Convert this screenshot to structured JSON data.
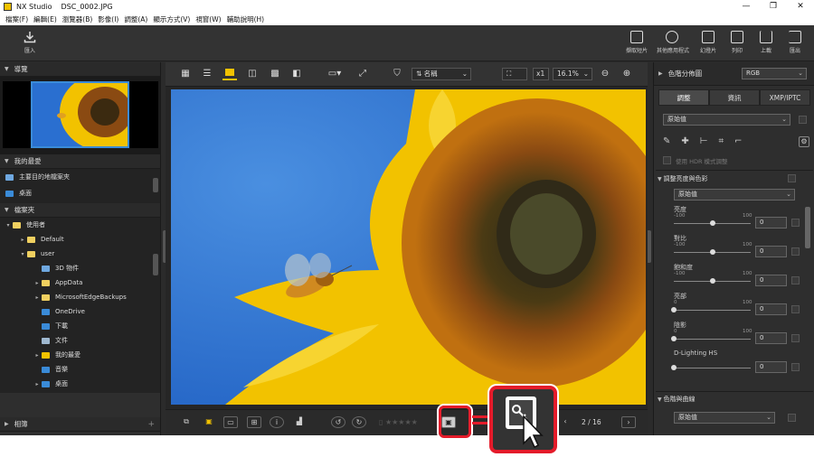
{
  "window": {
    "app_name": "NX Studio",
    "file_name": "DSC_0002.JPG"
  },
  "menu": [
    "檔案(F)",
    "編輯(E)",
    "瀏覽器(B)",
    "影像(I)",
    "調整(A)",
    "顯示方式(V)",
    "視窗(W)",
    "輔助說明(H)"
  ],
  "toolbar": {
    "import": "匯入",
    "right": [
      "擷取短片",
      "其他應用程式",
      "幻燈片",
      "列印",
      "上載",
      "匯出"
    ]
  },
  "left": {
    "navigation_title": "導覽",
    "favorites_title": "我的最愛",
    "favorites_item": "主要目的地檔案夾",
    "desktop_partial": "桌面",
    "folders_title": "檔案夾",
    "tree": [
      {
        "label": "使用者",
        "indent": 0,
        "arrow": "▾",
        "icon": "folder"
      },
      {
        "label": "Default",
        "indent": 1,
        "arrow": "▸",
        "icon": "folder"
      },
      {
        "label": "user",
        "indent": 1,
        "arrow": "▾",
        "icon": "folder"
      },
      {
        "label": "3D 物件",
        "indent": 2,
        "arrow": "",
        "icon": "cube"
      },
      {
        "label": "AppData",
        "indent": 2,
        "arrow": "▸",
        "icon": "folder"
      },
      {
        "label": "MicrosoftEdgeBackups",
        "indent": 2,
        "arrow": "▸",
        "icon": "folder"
      },
      {
        "label": "OneDrive",
        "indent": 2,
        "arrow": "",
        "icon": "cloud"
      },
      {
        "label": "下載",
        "indent": 2,
        "arrow": "",
        "icon": "download"
      },
      {
        "label": "文件",
        "indent": 2,
        "arrow": "",
        "icon": "doc"
      },
      {
        "label": "我的最愛",
        "indent": 2,
        "arrow": "▸",
        "icon": "star"
      },
      {
        "label": "音樂",
        "indent": 2,
        "arrow": "",
        "icon": "music"
      },
      {
        "label": "桌面",
        "indent": 2,
        "arrow": "▸",
        "icon": "desktop"
      }
    ],
    "album_title": "相簿"
  },
  "viewer_toolbar": {
    "sort_label": "名稱",
    "zoom_mult": "x1",
    "zoom_value": "16.1%"
  },
  "bottom": {
    "page_counter": "2 / 16"
  },
  "right": {
    "histogram_title": "色階分佈圖",
    "histogram_mode": "RGB",
    "tabs": [
      "調整",
      "資訊",
      "XMP/IPTC"
    ],
    "preset": "原始值",
    "hdr_label": "使用 HDR 模式調整",
    "section_brightness": "調整亮度與色彩",
    "section_preset": "原始值",
    "sliders": [
      {
        "label": "亮度",
        "min": "-100",
        "max": "100",
        "value": "0",
        "level": 0.5,
        "ranged": true
      },
      {
        "label": "對比",
        "min": "-100",
        "max": "100",
        "value": "0",
        "level": 0.5,
        "ranged": true
      },
      {
        "label": "飽和度",
        "min": "-100",
        "max": "100",
        "value": "0",
        "level": 0.5,
        "ranged": true
      },
      {
        "label": "亮部",
        "min": "0",
        "max": "100",
        "value": "0",
        "level": 0.0,
        "ranged": true
      },
      {
        "label": "陰影",
        "min": "0",
        "max": "100",
        "value": "0",
        "level": 0.0,
        "ranged": true
      },
      {
        "label": "D-Lighting HS",
        "min": "",
        "max": "",
        "value": "0",
        "level": 0.0,
        "ranged": false
      }
    ],
    "section_tone": "色階與曲線",
    "tone_preset": "原始值"
  },
  "colors": {
    "accent_yellow": "#f2c200",
    "callout_red": "#e41b2a",
    "sky_blue": "#2a6fd0"
  }
}
